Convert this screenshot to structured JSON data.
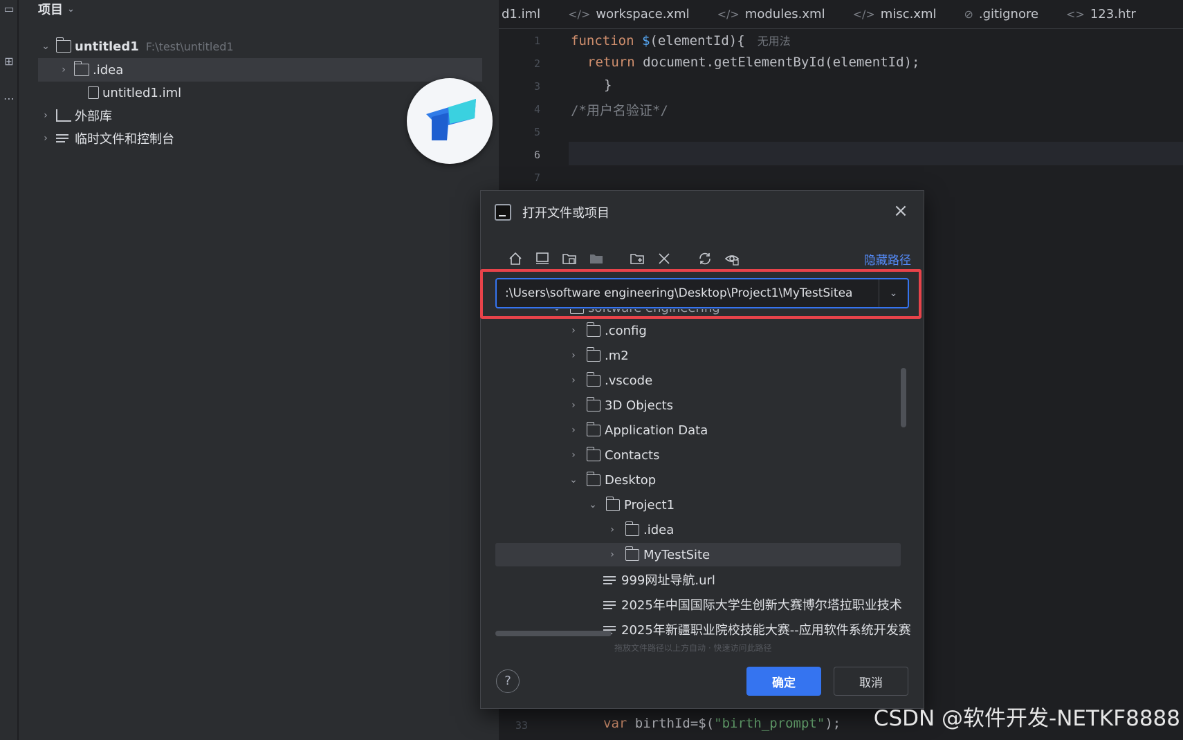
{
  "project_panel": {
    "title": "项目",
    "tree": [
      {
        "label": "untitled1",
        "path": "F:\\test\\untitled1"
      },
      {
        "label": ".idea"
      },
      {
        "label": "untitled1.iml"
      },
      {
        "label": "外部库"
      },
      {
        "label": "临时文件和控制台"
      }
    ]
  },
  "tabs": [
    {
      "label": "d1.iml",
      "icon": ""
    },
    {
      "label": "workspace.xml",
      "icon": "</>"
    },
    {
      "label": "modules.xml",
      "icon": "</>"
    },
    {
      "label": "misc.xml",
      "icon": "</>"
    },
    {
      "label": ".gitignore",
      "icon": "⊘"
    },
    {
      "label": "123.htr",
      "icon": "<>"
    }
  ],
  "editor": {
    "line_numbers": [
      "1",
      "2",
      "3",
      "4",
      "5",
      "6",
      "7"
    ],
    "line1_kw": "function ",
    "line1_fn": "$",
    "line1_rest": "(elementId){",
    "line1_hint": "无用法",
    "line2_kw": "return ",
    "line2_rest": "document.getElementById(elementId);",
    "line3": "}",
    "line4": "/*用户名验证*/",
    "bottom_ln": "33",
    "bottom_kw": "var ",
    "bottom_rest1": "birthId=$(",
    "bottom_str": "\"birth_prompt\"",
    "bottom_rest2": ");"
  },
  "dialog": {
    "title": "打开文件或项目",
    "hide_path": "隐藏路径",
    "path_value": ":\\Users\\software engineering\\Desktop\\Project1\\MyTestSitea",
    "tree": [
      {
        "label": "software engineering"
      },
      {
        "label": ".config"
      },
      {
        "label": ".m2"
      },
      {
        "label": ".vscode"
      },
      {
        "label": "3D Objects"
      },
      {
        "label": "Application Data"
      },
      {
        "label": "Contacts"
      },
      {
        "label": "Desktop"
      },
      {
        "label": "Project1"
      },
      {
        "label": ".idea"
      },
      {
        "label": "MyTestSite"
      },
      {
        "label": "999网址导航.url"
      },
      {
        "label": "2025年中国国际大学生创新大赛博尔塔拉职业技术"
      },
      {
        "label": "2025年新疆职业院校技能大赛--应用软件系统开发赛"
      }
    ],
    "faint_text": "拖放文件路径以上方自动 · 快速访问此路径",
    "ok": "确定",
    "cancel": "取消",
    "help": "?"
  },
  "watermark": "CSDN @软件开发-NETKF8888",
  "colors": {
    "accent": "#3574f0",
    "highlight": "#e8434a"
  }
}
